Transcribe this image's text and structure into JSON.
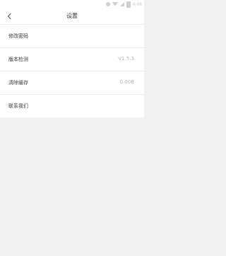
{
  "status_bar": {
    "time": "4:48",
    "icons": [
      "notification-icon",
      "wifi-icon",
      "signal-icon",
      "battery-icon"
    ]
  },
  "header": {
    "title": "设置",
    "back_icon": "chevron-left-icon"
  },
  "settings": {
    "items": [
      {
        "label": "修改密码",
        "value": ""
      },
      {
        "label": "版本检测",
        "value": "V1.5.3"
      },
      {
        "label": "清除缓存",
        "value": "0.00B"
      },
      {
        "label": "联系我们",
        "value": ""
      }
    ]
  },
  "colors": {
    "background": "#f2f2f2",
    "surface": "#ffffff",
    "text_primary": "#333333",
    "text_secondary": "#b8b8b8",
    "divider": "#ececec"
  }
}
